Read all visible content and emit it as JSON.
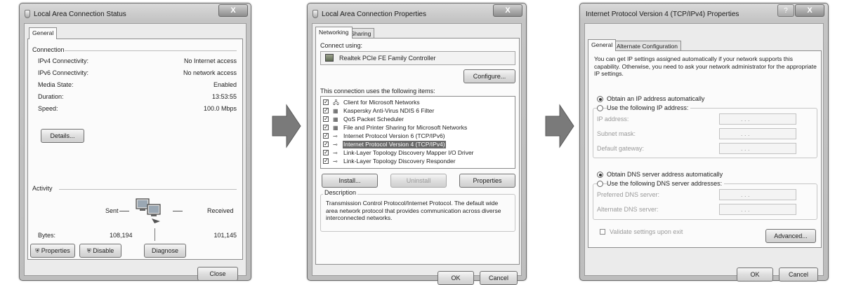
{
  "status_dialog": {
    "title": "Local Area Connection Status",
    "close_glyph": "X",
    "tab_general": "General",
    "connection_heading": "Connection",
    "rows": [
      {
        "label": "IPv4 Connectivity:",
        "value": "No Internet access"
      },
      {
        "label": "IPv6 Connectivity:",
        "value": "No network access"
      },
      {
        "label": "Media State:",
        "value": "Enabled"
      },
      {
        "label": "Duration:",
        "value": "13:53:55"
      },
      {
        "label": "Speed:",
        "value": "100.0 Mbps"
      }
    ],
    "details_button": "Details...",
    "activity_heading": "Activity",
    "sent_label": "Sent",
    "received_label": "Received",
    "bytes_label": "Bytes:",
    "bytes_sent": "108,194",
    "bytes_received": "101,145",
    "properties_button": "Properties",
    "disable_button": "Disable",
    "diagnose_button": "Diagnose",
    "close_button": "Close"
  },
  "properties_dialog": {
    "title": "Local Area Connection Properties",
    "close_glyph": "X",
    "tab_networking": "Networking",
    "tab_sharing": "Sharing",
    "connect_using_label": "Connect using:",
    "adapter_name": "Realtek PCIe FE Family Controller",
    "configure_button": "Configure...",
    "items_label": "This connection uses the following items:",
    "items": [
      {
        "label": "Client for Microsoft Networks",
        "checked": true,
        "icon": "network-client-icon"
      },
      {
        "label": "Kaspersky Anti-Virus NDIS 6 Filter",
        "checked": true,
        "icon": "service-icon"
      },
      {
        "label": "QoS Packet Scheduler",
        "checked": true,
        "icon": "service-icon"
      },
      {
        "label": "File and Printer Sharing for Microsoft Networks",
        "checked": true,
        "icon": "service-icon"
      },
      {
        "label": "Internet Protocol Version 6 (TCP/IPv6)",
        "checked": true,
        "icon": "protocol-icon"
      },
      {
        "label": "Internet Protocol Version 4 (TCP/IPv4)",
        "checked": true,
        "icon": "protocol-icon",
        "selected": true
      },
      {
        "label": "Link-Layer Topology Discovery Mapper I/O Driver",
        "checked": true,
        "icon": "protocol-icon"
      },
      {
        "label": "Link-Layer Topology Discovery Responder",
        "checked": true,
        "icon": "protocol-icon"
      }
    ],
    "install_button": "Install...",
    "uninstall_button": "Uninstall",
    "properties_button": "Properties",
    "description_heading": "Description",
    "description_text": "Transmission Control Protocol/Internet Protocol. The default wide area network protocol that provides communication across diverse interconnected networks.",
    "ok_button": "OK",
    "cancel_button": "Cancel"
  },
  "ipv4_dialog": {
    "title": "Internet Protocol Version 4 (TCP/IPv4) Properties",
    "help_glyph": "?",
    "close_glyph": "X",
    "tab_general": "General",
    "tab_alternate": "Alternate Configuration",
    "intro_text": "You can get IP settings assigned automatically if your network supports this capability. Otherwise, you need to ask your network administrator for the appropriate IP settings.",
    "obtain_ip_auto": "Obtain an IP address automatically",
    "use_following_ip": "Use the following IP address:",
    "ip_address_label": "IP address:",
    "subnet_mask_label": "Subnet mask:",
    "default_gateway_label": "Default gateway:",
    "obtain_dns_auto": "Obtain DNS server address automatically",
    "use_following_dns": "Use the following DNS server addresses:",
    "preferred_dns_label": "Preferred DNS server:",
    "alternate_dns_label": "Alternate DNS server:",
    "validate_label": "Validate settings upon exit",
    "advanced_button": "Advanced...",
    "ok_button": "OK",
    "cancel_button": "Cancel",
    "ip_dots": ".    .    ."
  },
  "colors": {
    "arrow_fill": "#7a7a7a",
    "selection": "#6a6a6a"
  }
}
